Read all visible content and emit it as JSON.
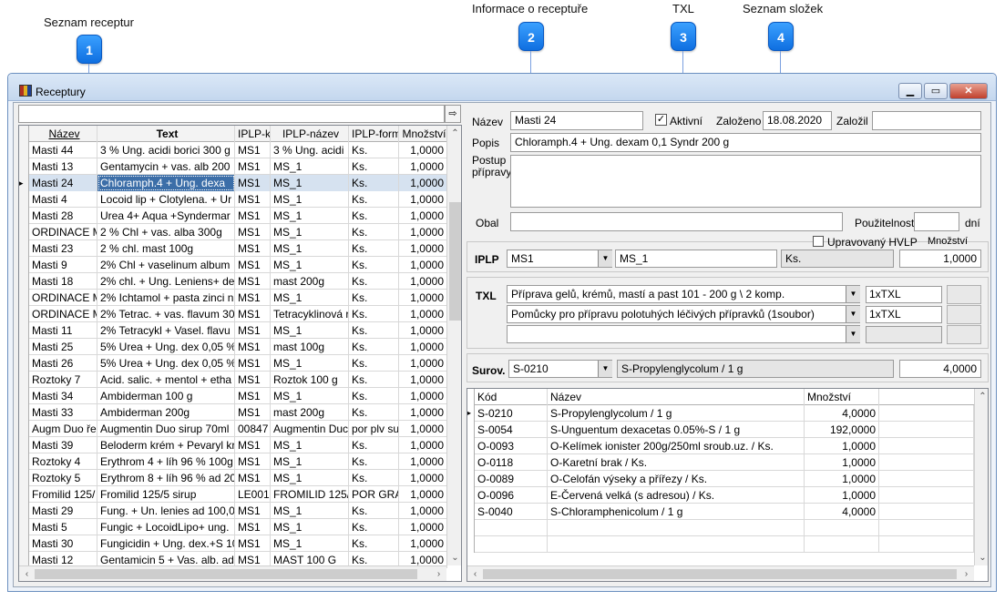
{
  "annotations": [
    {
      "num": "1",
      "label": "Seznam receptur"
    },
    {
      "num": "2",
      "label": "Informace o receptuře"
    },
    {
      "num": "3",
      "label": "TXL"
    },
    {
      "num": "4",
      "label": "Seznam složek"
    }
  ],
  "window": {
    "title": "Receptury",
    "minimize_icon": "minimize-icon",
    "maximize_icon": "maximize-icon",
    "close_icon": "close-icon"
  },
  "recipe_list": {
    "filter_value": "",
    "columns": [
      "Název",
      "Text",
      "IPLP-kó",
      "IPLP-název",
      "IPLP-form",
      "Množství"
    ],
    "rows": [
      [
        "Masti 44",
        "3 % Ung. acidi borici 300 g",
        "MS1",
        "3 % Ung. acidi",
        "Ks.",
        "1,0000"
      ],
      [
        "Masti 13",
        "Gentamycin + vas. alb 200",
        "MS1",
        "MS_1",
        "Ks.",
        "1,0000"
      ],
      [
        "Masti 24",
        "Chloramph.4 + Ung. dexa",
        "MS1",
        "MS_1",
        "Ks.",
        "1,0000"
      ],
      [
        "Masti 4",
        "Locoid lip + Clotylena. + Ur",
        "MS1",
        "MS_1",
        "Ks.",
        "1,0000"
      ],
      [
        "Masti 28",
        "Urea 4+ Aqua +Syndermar",
        "MS1",
        "MS_1",
        "Ks.",
        "1,0000"
      ],
      [
        "ORDINACE M",
        "2 % Chl + vas. alba 300g",
        "MS1",
        "MS_1",
        "Ks.",
        "1,0000"
      ],
      [
        "Masti 23",
        "2 % chl. mast 100g",
        "MS1",
        "MS_1",
        "Ks.",
        "1,0000"
      ],
      [
        "Masti 9",
        "2% Chl + vaselinum album",
        "MS1",
        "MS_1",
        "Ks.",
        "1,0000"
      ],
      [
        "Masti 18",
        "2% chl. + Ung. Leniens+ de",
        "MS1",
        "mast 200g",
        "Ks.",
        "1,0000"
      ],
      [
        "ORDINACE M",
        "2% Ichtamol + pasta zinci n",
        "MS1",
        "MS_1",
        "Ks.",
        "1,0000"
      ],
      [
        "ORDINACE M",
        "2% Tetrac. + vas. flavum 30",
        "MS1",
        "Tetracyklinová r",
        "Ks.",
        "1,0000"
      ],
      [
        "Masti 11",
        "2% Tetracykl + Vasel. flavu",
        "MS1",
        "MS_1",
        "Ks.",
        "1,0000"
      ],
      [
        "Masti 25",
        "5% Urea + Ung. dex 0,05 %",
        "MS1",
        "mast 100g",
        "Ks.",
        "1,0000"
      ],
      [
        "Masti 26",
        "5% Urea + Ung. dex 0,05 %",
        "MS1",
        "MS_1",
        "Ks.",
        "1,0000"
      ],
      [
        "Roztoky 7",
        "Acid. salic. + mentol + etha",
        "MS1",
        "Roztok 100 g",
        "Ks.",
        "1,0000"
      ],
      [
        "Masti 34",
        "Ambiderman 100 g",
        "MS1",
        "MS_1",
        "Ks.",
        "1,0000"
      ],
      [
        "Masti 33",
        "Ambiderman 200g",
        "MS1",
        "mast 200g",
        "Ks.",
        "1,0000"
      ],
      [
        "Augm Duo ře",
        "Augmentin Duo sirup 70ml",
        "00847",
        "Augmentin Duc",
        "por plv su",
        "1,0000"
      ],
      [
        "Masti 39",
        "Beloderm krém + Pevaryl kr",
        "MS1",
        "MS_1",
        "Ks.",
        "1,0000"
      ],
      [
        "Roztoky 4",
        "Erythrom 4 + líh 96 % 100g",
        "MS1",
        "MS_1",
        "Ks.",
        "1,0000"
      ],
      [
        "Roztoky 5",
        "Erythrom 8 + líh 96 % ad 20",
        "MS1",
        "MS_1",
        "Ks.",
        "1,0000"
      ],
      [
        "Fromilid 125/",
        "Fromilid 125/5 sirup",
        "LE001",
        "FROMILID 125/",
        "POR GRA",
        "1,0000"
      ],
      [
        "Masti 29",
        "Fung. + Un. lenies ad 100,0",
        "MS1",
        "MS_1",
        "Ks.",
        "1,0000"
      ],
      [
        "Masti 5",
        "Fungic + LocoidLipo+ ung.",
        "MS1",
        "MS_1",
        "Ks.",
        "1,0000"
      ],
      [
        "Masti 30",
        "Fungicidin + Ung. dex.+S 10",
        "MS1",
        "MS_1",
        "Ks.",
        "1,0000"
      ],
      [
        "Masti 12",
        "Gentamicin 5 + Vas. alb. ad",
        "MS1",
        "MAST 100 G",
        "Ks.",
        "1,0000"
      ]
    ],
    "selected_index": 2
  },
  "form": {
    "nazev_label": "Název",
    "nazev_value": "Masti 24",
    "aktivni_label": "Aktivní",
    "aktivni_checked": "✓",
    "zalozeno_label": "Založeno",
    "zalozeno_value": "18.08.2020",
    "zalozil_label": "Založil",
    "zalozil_value": "",
    "popis_label": "Popis",
    "popis_value": "Chloramph.4 + Ung. dexam 0,1 Syndr 200 g",
    "postup_label": "Postup přípravy",
    "postup_value": "",
    "obal_label": "Obal",
    "obal_value": "",
    "pouzitelnost_label": "Použitelnost",
    "pouzitelnost_value": "",
    "dni_label": "dní"
  },
  "iplp": {
    "label": "IPLP",
    "code": "MS1",
    "name": "MS_1",
    "form": "Ks.",
    "upraveny_label": "Upravovaný HVLP",
    "mnozstvi_label": "Množství",
    "mnozstvi_value": "1,0000"
  },
  "txl": {
    "label": "TXL",
    "rows": [
      {
        "value": "Příprava gelů, krémů, mastí a past 101 - 200 g \\ 2 komp.",
        "qty": "1xTXL"
      },
      {
        "value": "Pomůcky pro přípravu polotuhých léčivých přípravků (1soubor)",
        "qty": "1xTXL"
      },
      {
        "value": "",
        "qty": ""
      }
    ]
  },
  "surov": {
    "label": "Surov.",
    "code": "S-0210",
    "name": "S-Propylenglycolum / 1 g",
    "qty": "4,0000"
  },
  "ingredients": {
    "columns": [
      "Kód",
      "Název",
      "Množství"
    ],
    "rows": [
      [
        "S-0210",
        "S-Propylenglycolum / 1 g",
        "4,0000"
      ],
      [
        "S-0054",
        "S-Unguentum dexacetas 0.05%-S / 1 g",
        "192,0000"
      ],
      [
        "O-0093",
        "O-Kelímek ionister 200g/250ml sroub.uz. / Ks.",
        "1,0000"
      ],
      [
        "O-0118",
        "O-Karetní brak / Ks.",
        "1,0000"
      ],
      [
        "O-0089",
        "O-Celofán výseky a přířezy / Ks.",
        "1,0000"
      ],
      [
        "O-0096",
        "E-Červená velká (s adresou) / Ks.",
        "1,0000"
      ],
      [
        "S-0040",
        "S-Chloramphenicolum / 1 g",
        "4,0000"
      ]
    ]
  }
}
